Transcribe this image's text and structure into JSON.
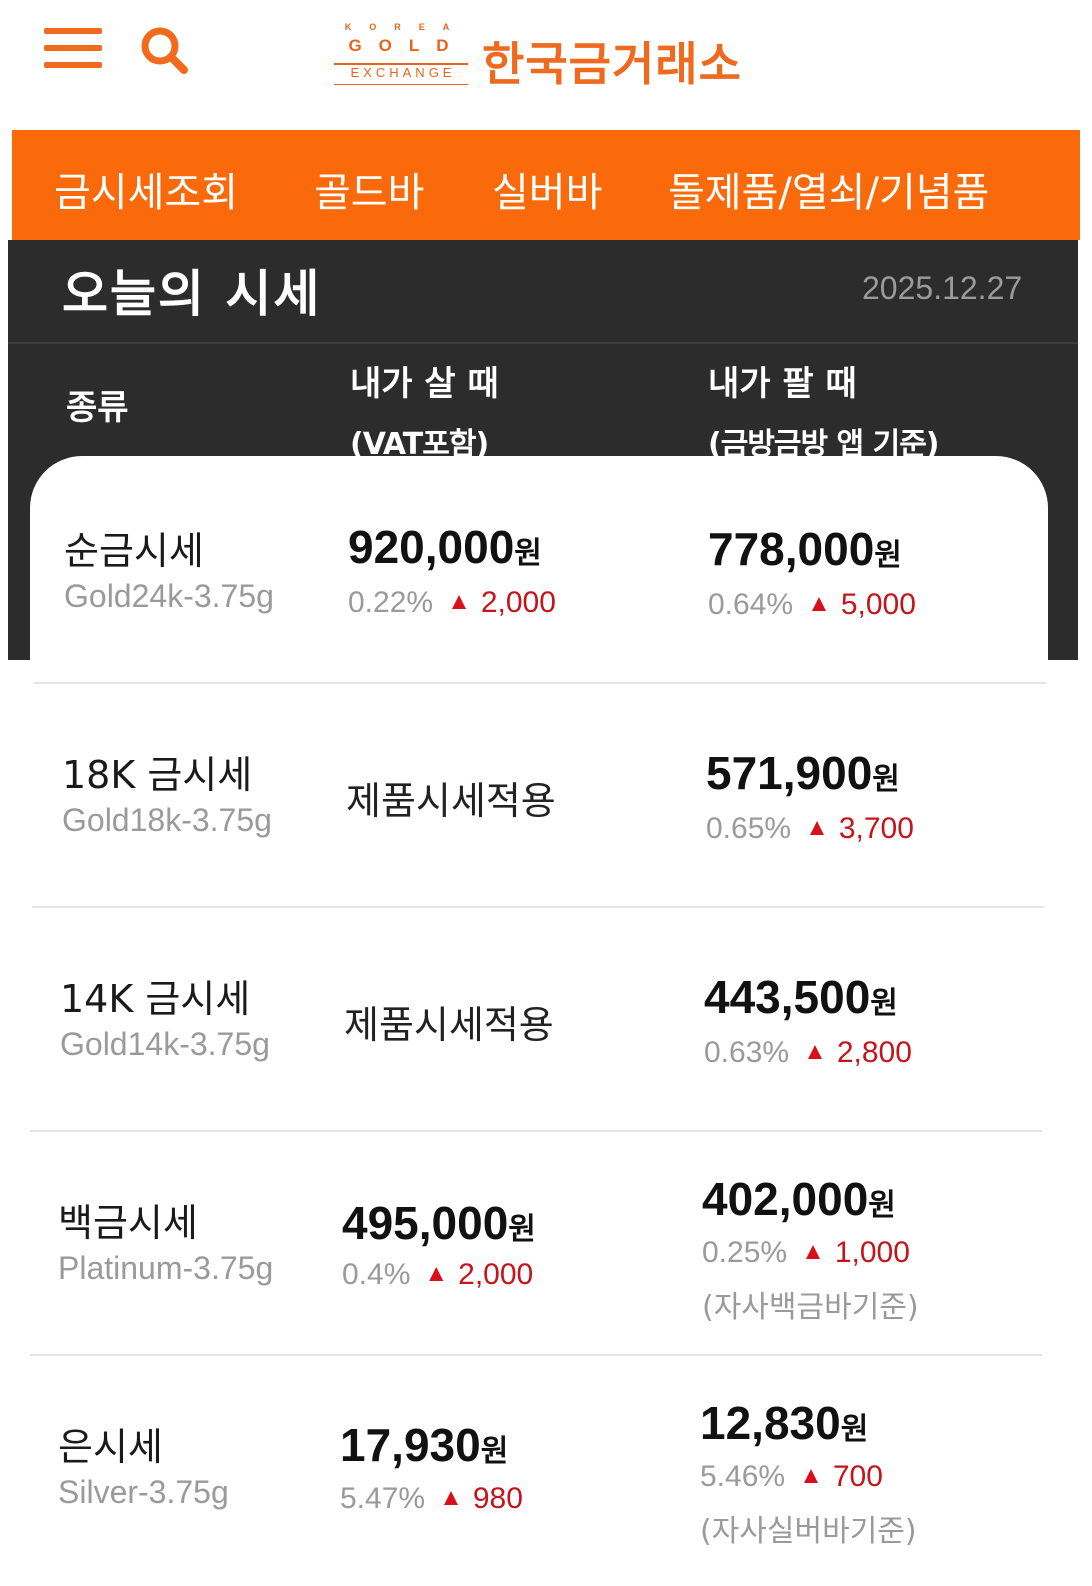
{
  "header": {
    "menu_icon": "hamburger-menu-icon",
    "search_icon": "search-icon",
    "logo": {
      "line1": "KOREA",
      "line2": "GOLD",
      "line3": "EXCHANGE",
      "name_ko": "한국금거래소"
    },
    "accent_color": "#fa6a0a"
  },
  "nav": {
    "items": [
      "금시세조회",
      "골드바",
      "실버바",
      "돌제품/열쇠/기념품"
    ]
  },
  "today": {
    "title": "오늘의 시세",
    "date": "2025.12.27"
  },
  "table": {
    "headers": {
      "kind": "종류",
      "buy_line1": "내가 살 때",
      "buy_line2": "(VAT포함)",
      "sell_line1": "내가 팔 때",
      "sell_line2": "(금방금방 앱 기준)"
    },
    "unit": "원",
    "up_icon": "up-triangle-icon",
    "up_color": "#d8101a",
    "rows": [
      {
        "name": "순금시세",
        "sub": "Gold24k-3.75g",
        "buy_price": "920,000",
        "buy_pct": "0.22%",
        "buy_change": "2,000",
        "sell_price": "778,000",
        "sell_pct": "0.64%",
        "sell_change": "5,000"
      },
      {
        "name": "18K 금시세",
        "sub": "Gold18k-3.75g",
        "buy_text": "제품시세적용",
        "sell_price": "571,900",
        "sell_pct": "0.65%",
        "sell_change": "3,700"
      },
      {
        "name": "14K 금시세",
        "sub": "Gold14k-3.75g",
        "buy_text": "제품시세적용",
        "sell_price": "443,500",
        "sell_pct": "0.63%",
        "sell_change": "2,800"
      },
      {
        "name": "백금시세",
        "sub": "Platinum-3.75g",
        "buy_price": "495,000",
        "buy_pct": "0.4%",
        "buy_change": "2,000",
        "sell_price": "402,000",
        "sell_pct": "0.25%",
        "sell_change": "1,000",
        "sell_note": "(자사백금바기준)"
      },
      {
        "name": "은시세",
        "sub": "Silver-3.75g",
        "buy_price": "17,930",
        "buy_pct": "5.47%",
        "buy_change": "980",
        "sell_price": "12,830",
        "sell_pct": "5.46%",
        "sell_change": "700",
        "sell_note": "(자사실버바기준)"
      }
    ]
  }
}
